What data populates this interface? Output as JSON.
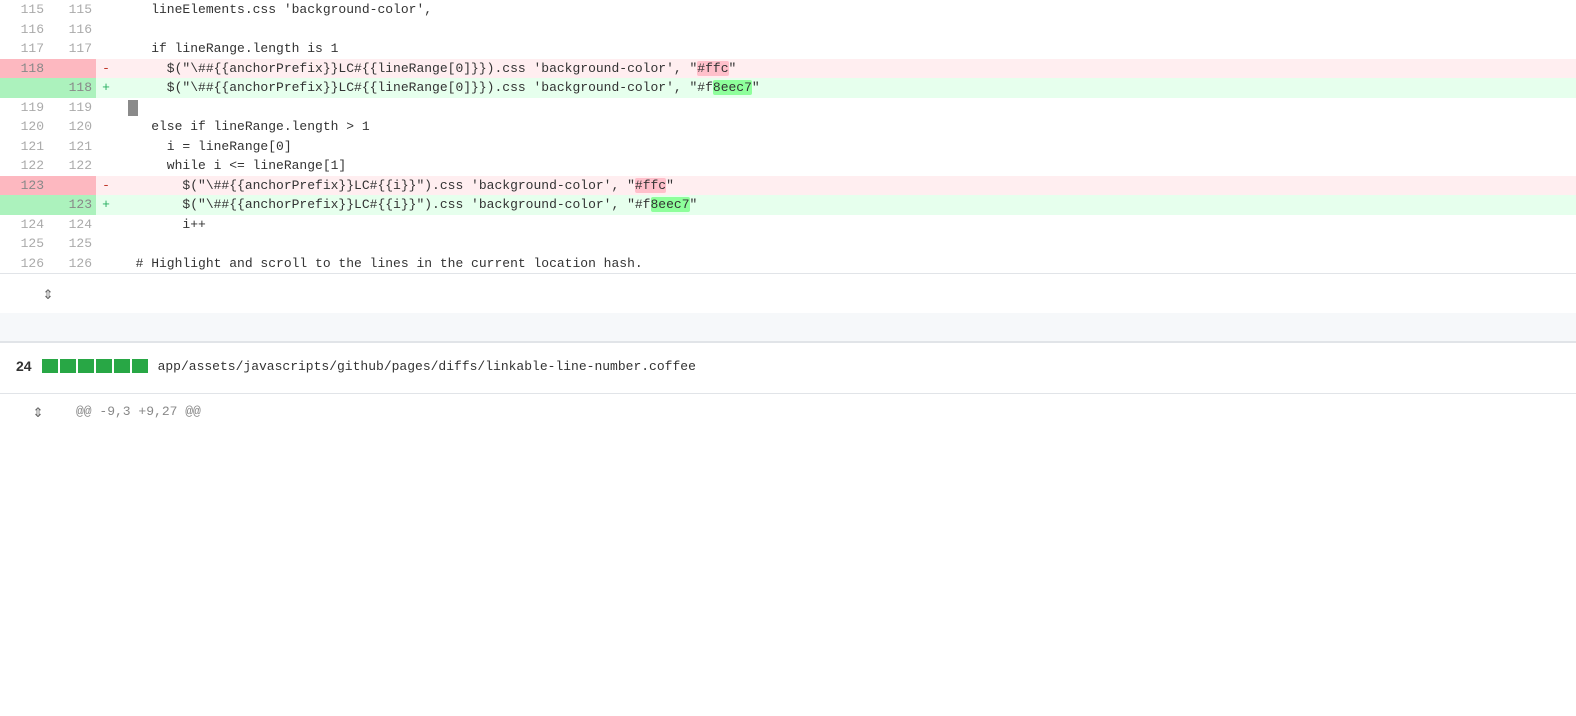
{
  "diff": {
    "lines": [
      {
        "id": "l115",
        "old_num": "115",
        "new_num": "115",
        "marker": "",
        "code": "    lineElements.css 'background-color',",
        "type": "normal"
      },
      {
        "id": "l116",
        "old_num": "116",
        "new_num": "116",
        "marker": "",
        "code": "",
        "type": "normal"
      },
      {
        "id": "l117",
        "old_num": "117",
        "new_num": "117",
        "marker": "",
        "code": "    if lineRange.length is 1",
        "type": "normal"
      },
      {
        "id": "l118d",
        "old_num": "118",
        "new_num": "",
        "marker": "-",
        "code": "      $(\"\\##{{anchorPrefix}}LC#{{lineRange[0]}}\").css 'background-color', \"#ffc\"",
        "type": "deleted",
        "hl_start": 1139,
        "hl_text": "#ffc",
        "hl_type": "red"
      },
      {
        "id": "l118a",
        "old_num": "",
        "new_num": "118",
        "marker": "+",
        "code": "      $(\"\\##{{anchorPrefix}}LC#{{lineRange[0]}}\").css 'background-color', \"#f8eec7\"",
        "type": "added",
        "hl_text": "8eec7",
        "hl_type": "green"
      },
      {
        "id": "l119",
        "old_num": "119",
        "new_num": "119",
        "marker": "",
        "code": "",
        "type": "normal",
        "has_cursor": true
      },
      {
        "id": "l120",
        "old_num": "120",
        "new_num": "120",
        "marker": "",
        "code": "    else if lineRange.length > 1",
        "type": "normal"
      },
      {
        "id": "l121",
        "old_num": "121",
        "new_num": "121",
        "marker": "",
        "code": "      i = lineRange[0]",
        "type": "normal"
      },
      {
        "id": "l122",
        "old_num": "122",
        "new_num": "122",
        "marker": "",
        "code": "      while i <= lineRange[1]",
        "type": "normal"
      },
      {
        "id": "l123d",
        "old_num": "123",
        "new_num": "",
        "marker": "-",
        "code": "        $(\"\\##{{anchorPrefix}}LC#{{i}}\").css 'background-color', \"#ffc\"",
        "type": "deleted"
      },
      {
        "id": "l123a",
        "old_num": "",
        "new_num": "123",
        "marker": "+",
        "code": "        $(\"\\##{{anchorPrefix}}LC#{{i}}\").css 'background-color', \"#f8eec7\"",
        "type": "added"
      },
      {
        "id": "l124",
        "old_num": "124",
        "new_num": "124",
        "marker": "",
        "code": "        i++",
        "type": "normal"
      },
      {
        "id": "l125",
        "old_num": "125",
        "new_num": "125",
        "marker": "",
        "code": "",
        "type": "normal"
      },
      {
        "id": "l126",
        "old_num": "126",
        "new_num": "126",
        "marker": "",
        "code": "  # Highlight and scroll to the lines in the current location hash.",
        "type": "normal"
      }
    ],
    "separator_icon": "⇕",
    "file_section": {
      "num": "24",
      "stat_blocks": 6,
      "path": "app/assets/javascripts/github/pages/diffs/linkable-line-number.coffee"
    },
    "hunk_header": {
      "icon": "⇕",
      "text": "@@ -9,3 +9,27 @@"
    }
  }
}
